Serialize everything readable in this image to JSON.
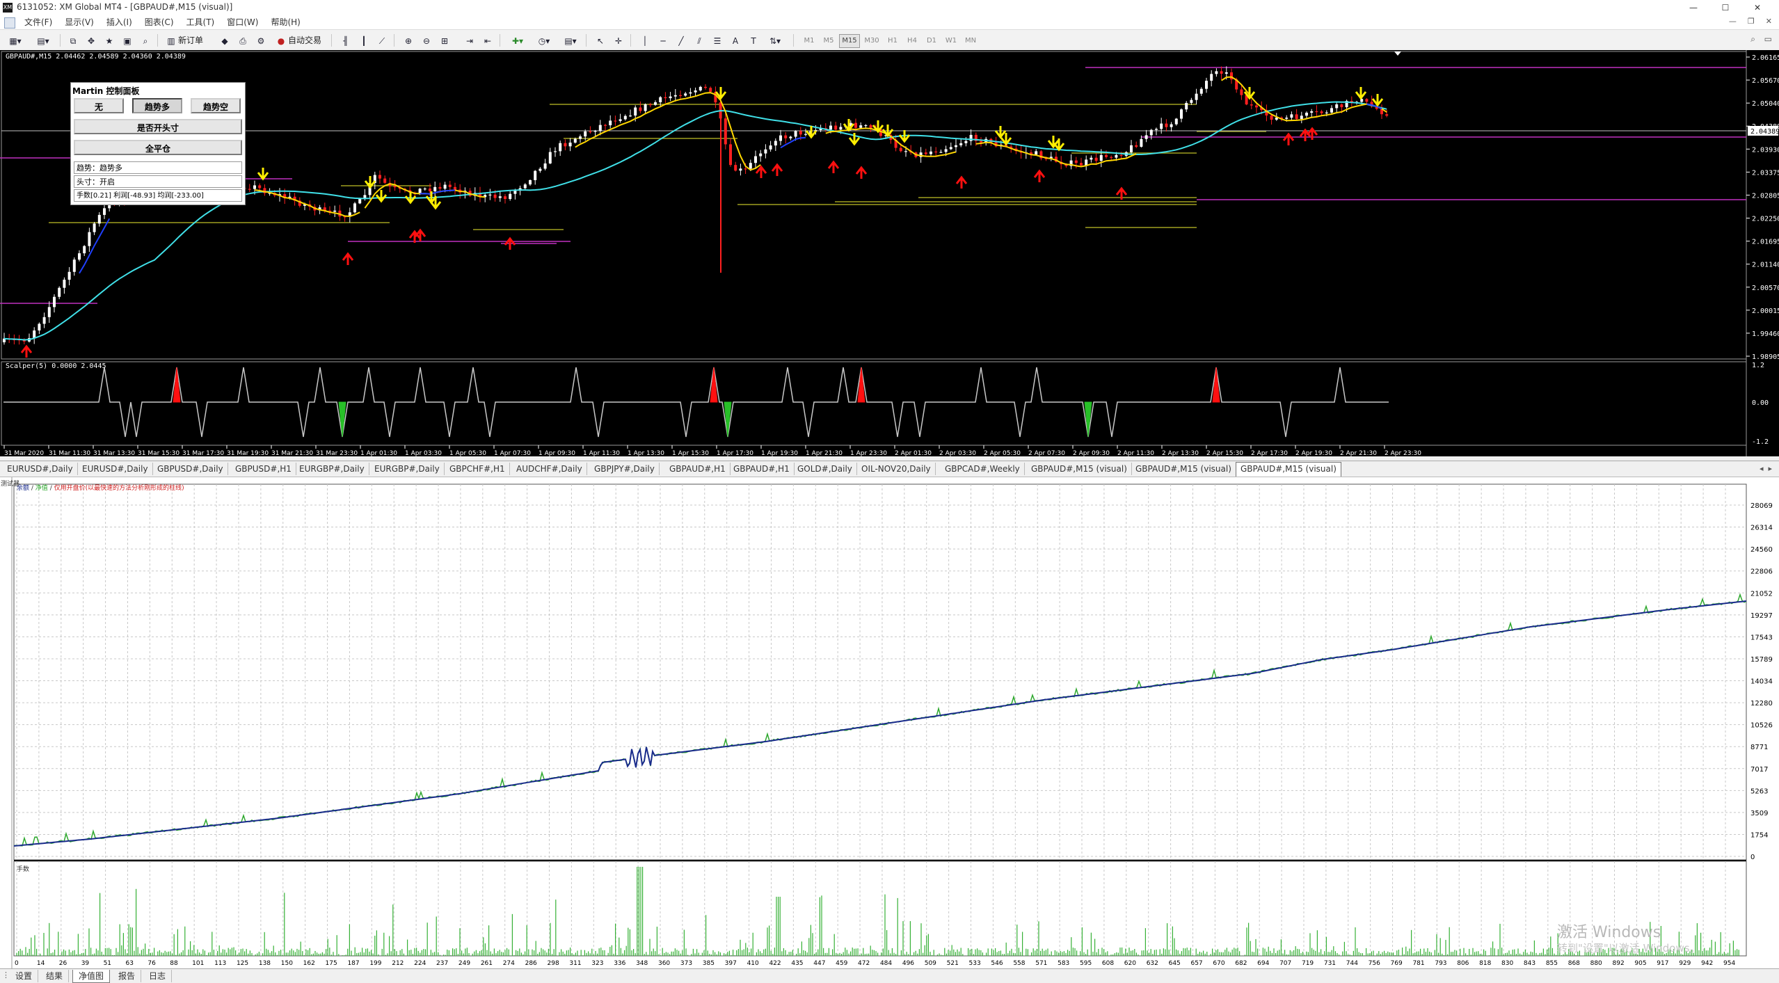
{
  "window": {
    "title": "6131052: XM Global MT4 - [GBPAUD#,M15 (visual)]",
    "app_icon": "XM",
    "controls": [
      "—",
      "☐",
      "✕"
    ]
  },
  "menu": {
    "items": [
      "文件(F)",
      "显示(V)",
      "插入(I)",
      "图表(C)",
      "工具(T)",
      "窗口(W)",
      "帮助(H)"
    ],
    "mdi_controls": [
      "—",
      "❐",
      "✕"
    ]
  },
  "toolbar": {
    "new_order": "新订单",
    "auto_trade": "自动交易",
    "timeframes": [
      "M1",
      "M5",
      "M15",
      "M30",
      "H1",
      "H4",
      "D1",
      "W1",
      "MN"
    ],
    "active_timeframe": "M15"
  },
  "chart": {
    "header": "GBPAUD#,M15  2.04462 2.04589 2.04360 2.04389",
    "subwindow_label": "Scalper(5) 0.0000 2.0445",
    "current_price": "2.04389",
    "price_ticks": [
      "2.06165",
      "2.05670",
      "2.05040",
      "2.04389",
      "2.03930",
      "2.03375",
      "2.02805",
      "2.02250",
      "2.01695",
      "2.01140",
      "2.00570",
      "2.00015",
      "1.99460",
      "1.98905"
    ],
    "sub_ticks": [
      "1.2",
      "0.00",
      "-1.2"
    ],
    "time_ticks": [
      "31 Mar 2020",
      "31 Mar 11:30",
      "31 Mar 13:30",
      "31 Mar 15:30",
      "31 Mar 17:30",
      "31 Mar 19:30",
      "31 Mar 21:30",
      "31 Mar 23:30",
      "1 Apr 01:30",
      "1 Apr 03:30",
      "1 Apr 05:30",
      "1 Apr 07:30",
      "1 Apr 09:30",
      "1 Apr 11:30",
      "1 Apr 13:30",
      "1 Apr 15:30",
      "1 Apr 17:30",
      "1 Apr 19:30",
      "1 Apr 21:30",
      "1 Apr 23:30",
      "2 Apr 01:30",
      "2 Apr 03:30",
      "2 Apr 05:30",
      "2 Apr 07:30",
      "2 Apr 09:30",
      "2 Apr 11:30",
      "2 Apr 13:30",
      "2 Apr 15:30",
      "2 Apr 17:30",
      "2 Apr 19:30",
      "2 Apr 21:30",
      "2 Apr 23:30"
    ],
    "colors": {
      "bull": "#ffffff",
      "bear": "#ff2020",
      "ma_fast": "#ffd700",
      "ma_slow": "#40e0e8",
      "sr": "#a0a020",
      "magenta": "#c030c0",
      "arrow_up": "#ff1010",
      "arrow_down": "#ffee00",
      "bg": "#000000"
    }
  },
  "panel": {
    "title": "Martin 控制面板",
    "buttons": [
      "无",
      "趋势多",
      "趋势空"
    ],
    "active_button": 1,
    "open_button": "是否开头寸",
    "close_all": "全平仓",
    "trend_line": "趋势：趋势多",
    "position_line": "头寸：开启",
    "stats_line": "手数[0.21]  利润[-48.93]  均润[-233.00]"
  },
  "tabs": {
    "items": [
      "EURUSD#,Daily",
      "EURUSD#,Daily",
      "GBPUSD#,Daily",
      "GBPUSD#,H1",
      "EURGBP#,Daily",
      "EURGBP#,Daily",
      "GBPCHF#,H1",
      "AUDCHF#,Daily",
      "GBPJPY#,Daily",
      "GBPAUD#,H1",
      "GBPAUD#,H1",
      "GOLD#,Daily",
      "OIL-NOV20,Daily",
      "GBPCAD#,Weekly",
      "GBPAUD#,M15 (visual)",
      "GBPAUD#,M15 (visual)",
      "GBPAUD#,M15 (visual)"
    ],
    "active": 16,
    "nav": [
      "◂",
      "▸"
    ]
  },
  "strategy": {
    "side_label": "测试器",
    "legend": [
      "余额",
      "净值",
      "仅用开盘价(以最快速的方法分析刚形成的柱线)"
    ],
    "volume_label": "手数",
    "balance_ticks": [
      "28069",
      "26314",
      "24560",
      "22806",
      "21052",
      "19297",
      "17543",
      "15789",
      "14034",
      "12280",
      "10526",
      "8771",
      "7017",
      "5263",
      "3509",
      "1754",
      "0"
    ],
    "trade_ticks": [
      "0",
      "14",
      "26",
      "39",
      "51",
      "63",
      "76",
      "88",
      "101",
      "113",
      "125",
      "138",
      "150",
      "162",
      "175",
      "187",
      "199",
      "212",
      "224",
      "237",
      "249",
      "261",
      "274",
      "286",
      "298",
      "311",
      "323",
      "336",
      "348",
      "360",
      "373",
      "385",
      "397",
      "410",
      "422",
      "435",
      "447",
      "459",
      "472",
      "484",
      "496",
      "509",
      "521",
      "533",
      "546",
      "558",
      "571",
      "583",
      "595",
      "608",
      "620",
      "632",
      "645",
      "657",
      "670",
      "682",
      "694",
      "707",
      "719",
      "731",
      "744",
      "756",
      "769",
      "781",
      "793",
      "806",
      "818",
      "830",
      "843",
      "855",
      "868",
      "880",
      "892",
      "905",
      "917",
      "929",
      "942",
      "954"
    ],
    "colors": {
      "balance": "#1a2b8c",
      "equity": "#2ea82e",
      "grid": "#c8c8c8",
      "volume": "#35b035"
    }
  },
  "status_tabs": {
    "items": [
      "设置",
      "结果",
      "净值图",
      "报告",
      "日志"
    ],
    "active": 2
  },
  "watermark": {
    "line1": "激活 Windows",
    "line2": "转到\"设置\"以激活 Windows。"
  }
}
